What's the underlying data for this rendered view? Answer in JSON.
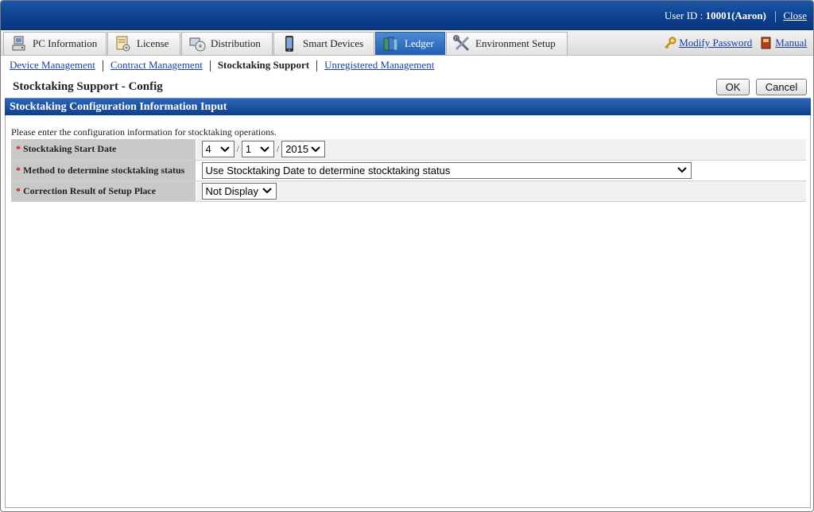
{
  "header": {
    "user_id_label": "User ID :",
    "user_id_value": "10001(Aaron)",
    "close_label": "Close"
  },
  "tabs": [
    {
      "label": "PC Information",
      "icon": "pc-icon",
      "active": false
    },
    {
      "label": "License",
      "icon": "license-icon",
      "active": false
    },
    {
      "label": "Distribution",
      "icon": "distribution-icon",
      "active": false
    },
    {
      "label": "Smart Devices",
      "icon": "smartphone-icon",
      "active": false
    },
    {
      "label": "Ledger",
      "icon": "ledger-books-icon",
      "active": true
    },
    {
      "label": "Environment Setup",
      "icon": "tools-icon",
      "active": false
    }
  ],
  "right_links": {
    "modify_password": "Modify Password",
    "manual": "Manual"
  },
  "submenu": [
    {
      "label": "Device Management",
      "current": false
    },
    {
      "label": "Contract Management",
      "current": false
    },
    {
      "label": "Stocktaking Support",
      "current": true
    },
    {
      "label": "Unregistered Management",
      "current": false
    }
  ],
  "page": {
    "title": "Stocktaking Support - Config",
    "ok_label": "OK",
    "cancel_label": "Cancel",
    "section_title": "Stocktaking Configuration Information Input",
    "intro": "Please enter the configuration information for stocktaking operations."
  },
  "form": {
    "required_mark": "*",
    "rows": [
      {
        "label": "Stocktaking Start Date"
      },
      {
        "label": "Method to determine stocktaking status"
      },
      {
        "label": "Correction Result of Setup Place"
      }
    ],
    "start_month": "4",
    "start_day": "1",
    "start_year": "2015",
    "date_separator": "/",
    "method_value": "Use Stocktaking Date to determine stocktaking status",
    "correction_value": "Not Display"
  },
  "colors": {
    "header_blue": "#0d3f8c",
    "link_blue": "#1a3fa3",
    "required_red": "#d01010"
  }
}
